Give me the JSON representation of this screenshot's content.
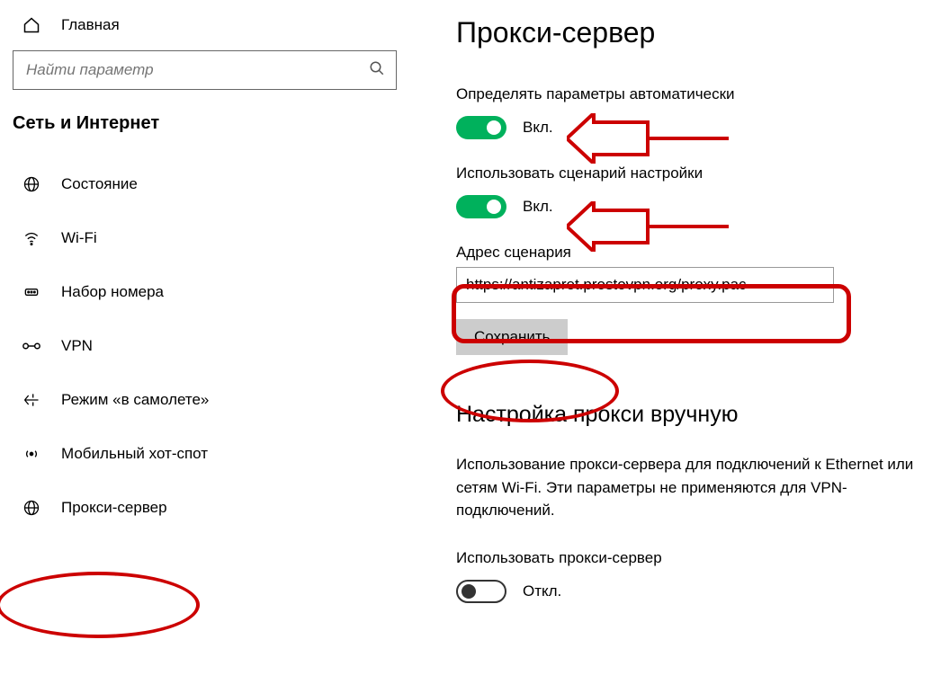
{
  "header": {
    "home_label": "Главная"
  },
  "search": {
    "placeholder": "Найти параметр"
  },
  "section_title": "Сеть и Интернет",
  "nav": {
    "items": [
      {
        "label": "Состояние",
        "icon": "globe"
      },
      {
        "label": "Wi-Fi",
        "icon": "wifi"
      },
      {
        "label": "Набор номера",
        "icon": "dialup"
      },
      {
        "label": "VPN",
        "icon": "vpn"
      },
      {
        "label": "Режим «в самолете»",
        "icon": "airplane"
      },
      {
        "label": "Мобильный хот-спот",
        "icon": "hotspot"
      },
      {
        "label": "Прокси-сервер",
        "icon": "globe"
      }
    ]
  },
  "main": {
    "title": "Прокси-сервер",
    "auto_label": "Определять параметры автоматически",
    "auto_state": "Вкл.",
    "script_toggle_label": "Использовать сценарий настройки",
    "script_state": "Вкл.",
    "script_addr_label": "Адрес сценария",
    "script_addr_value": "https://antizapret.prostovpn.org/proxy.pac",
    "save_label": "Сохранить",
    "manual_heading": "Настройка прокси вручную",
    "manual_desc": "Использование прокси-сервера для подключений к Ethernet или сетям Wi-Fi. Эти параметры не применяются для VPN-подключений.",
    "manual_toggle_label": "Использовать прокси-сервер",
    "manual_state": "Откл."
  }
}
